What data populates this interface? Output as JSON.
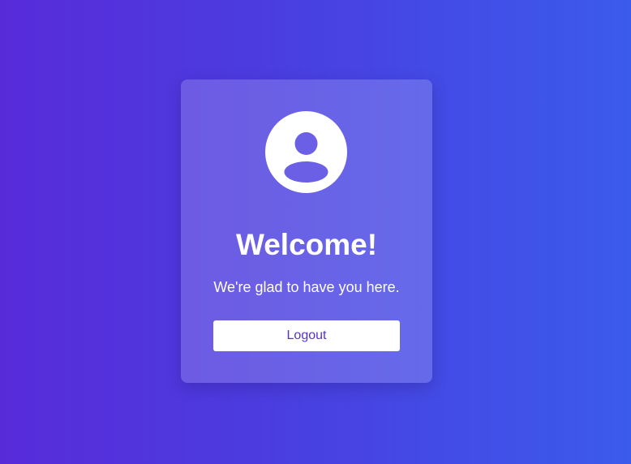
{
  "card": {
    "avatar_icon": "user-avatar-icon",
    "title": "Welcome!",
    "subtitle": "We're glad to have you here.",
    "logout_label": "Logout"
  },
  "colors": {
    "background_start": "#582bd9",
    "background_end": "#3b5bec",
    "button_text": "#5530d6",
    "text": "#ffffff"
  }
}
